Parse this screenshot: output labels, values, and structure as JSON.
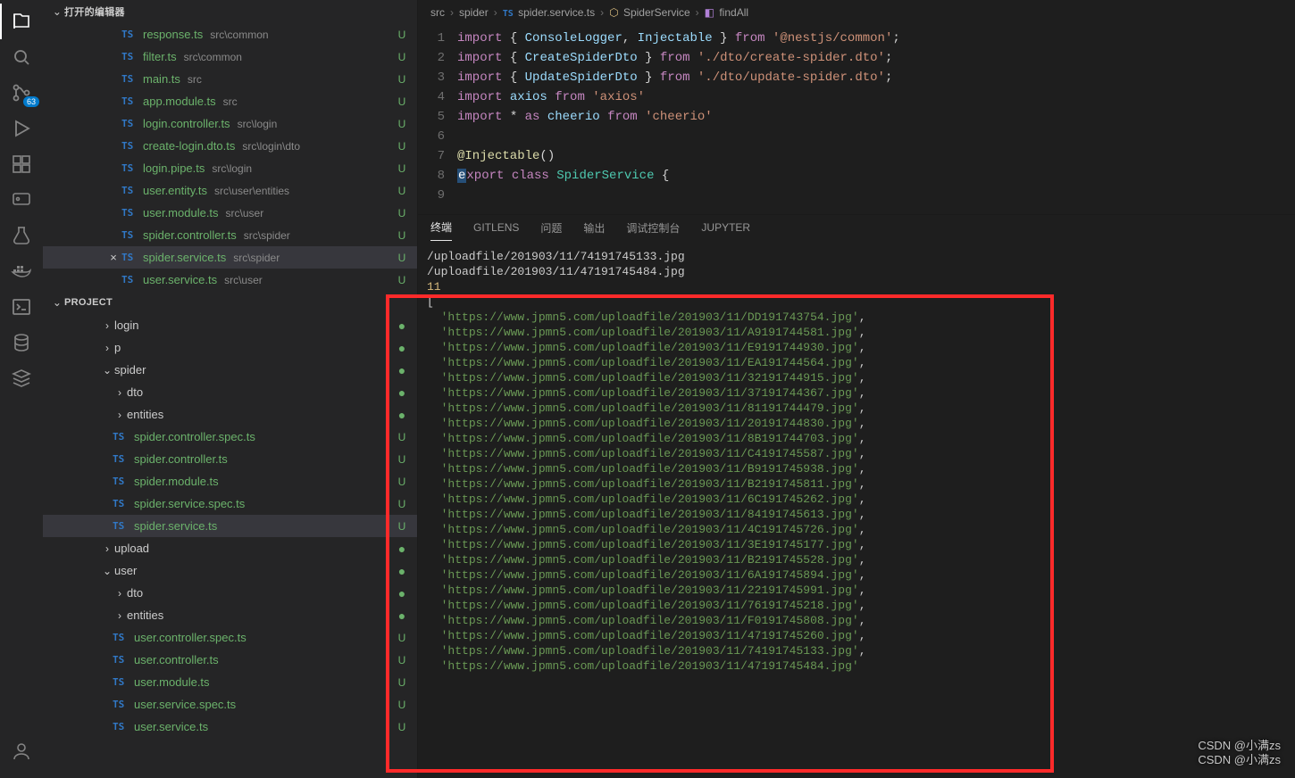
{
  "activity": {
    "icons": [
      {
        "name": "explorer-icon",
        "active": true
      },
      {
        "name": "search-icon"
      },
      {
        "name": "source-control-icon",
        "badge": "63"
      },
      {
        "name": "run-icon"
      },
      {
        "name": "extensions-icon"
      },
      {
        "name": "remote-icon"
      },
      {
        "name": "testing-icon"
      },
      {
        "name": "docker-icon"
      },
      {
        "name": "terminal-icon"
      },
      {
        "name": "database-icon"
      },
      {
        "name": "stack-icon"
      }
    ],
    "account_name": "account-icon"
  },
  "sidebar": {
    "openEditorsTitle": "打开的编辑器",
    "projectTitle": "PROJECT",
    "openEditors": [
      {
        "label": "response.ts",
        "dir": "src\\common",
        "status": "U"
      },
      {
        "label": "filter.ts",
        "dir": "src\\common",
        "status": "U"
      },
      {
        "label": "main.ts",
        "dir": "src",
        "status": "U"
      },
      {
        "label": "app.module.ts",
        "dir": "src",
        "status": "U"
      },
      {
        "label": "login.controller.ts",
        "dir": "src\\login",
        "status": "U"
      },
      {
        "label": "create-login.dto.ts",
        "dir": "src\\login\\dto",
        "status": "U"
      },
      {
        "label": "login.pipe.ts",
        "dir": "src\\login",
        "status": "U"
      },
      {
        "label": "user.entity.ts",
        "dir": "src\\user\\entities",
        "status": "U"
      },
      {
        "label": "user.module.ts",
        "dir": "src\\user",
        "status": "U"
      },
      {
        "label": "spider.controller.ts",
        "dir": "src\\spider",
        "status": "U"
      },
      {
        "label": "spider.service.ts",
        "dir": "src\\spider",
        "status": "U",
        "active": true
      },
      {
        "label": "user.service.ts",
        "dir": "src\\user",
        "status": "U"
      }
    ],
    "tree": [
      {
        "indent": 1,
        "chev": "›",
        "type": "folder",
        "label": "login",
        "status": "dot"
      },
      {
        "indent": 1,
        "chev": "›",
        "type": "folder",
        "label": "p",
        "status": "dot"
      },
      {
        "indent": 1,
        "chev": "⌄",
        "type": "folder",
        "label": "spider",
        "status": "dot"
      },
      {
        "indent": 2,
        "chev": "›",
        "type": "folder",
        "label": "dto",
        "status": "dot"
      },
      {
        "indent": 2,
        "chev": "›",
        "type": "folder",
        "label": "entities",
        "status": "dot"
      },
      {
        "indent": 2,
        "type": "ts",
        "label": "spider.controller.spec.ts",
        "status": "U"
      },
      {
        "indent": 2,
        "type": "ts",
        "label": "spider.controller.ts",
        "status": "U"
      },
      {
        "indent": 2,
        "type": "ts",
        "label": "spider.module.ts",
        "status": "U"
      },
      {
        "indent": 2,
        "type": "ts",
        "label": "spider.service.spec.ts",
        "status": "U"
      },
      {
        "indent": 2,
        "type": "ts",
        "label": "spider.service.ts",
        "status": "U",
        "selected": true
      },
      {
        "indent": 1,
        "chev": "›",
        "type": "folder",
        "label": "upload",
        "status": "dot"
      },
      {
        "indent": 1,
        "chev": "⌄",
        "type": "folder",
        "label": "user",
        "status": "dot"
      },
      {
        "indent": 2,
        "chev": "›",
        "type": "folder",
        "label": "dto",
        "status": "dot"
      },
      {
        "indent": 2,
        "chev": "›",
        "type": "folder",
        "label": "entities",
        "status": "dot"
      },
      {
        "indent": 2,
        "type": "ts",
        "label": "user.controller.spec.ts",
        "status": "U"
      },
      {
        "indent": 2,
        "type": "ts",
        "label": "user.controller.ts",
        "status": "U"
      },
      {
        "indent": 2,
        "type": "ts",
        "label": "user.module.ts",
        "status": "U"
      },
      {
        "indent": 2,
        "type": "ts",
        "label": "user.service.spec.ts",
        "status": "U"
      },
      {
        "indent": 2,
        "type": "ts",
        "label": "user.service.ts",
        "status": "U"
      }
    ]
  },
  "breadcrumbs": {
    "parts": [
      {
        "text": "src"
      },
      {
        "text": "spider"
      },
      {
        "icon": "ts",
        "text": "spider.service.ts"
      },
      {
        "icon": "class",
        "text": "SpiderService"
      },
      {
        "icon": "method",
        "text": "findAll"
      }
    ]
  },
  "code": {
    "lines": [
      1,
      2,
      3,
      4,
      5,
      6,
      7,
      8,
      9
    ],
    "l1": {
      "a": "import",
      "b": "ConsoleLogger",
      "c": "Injectable",
      "d": "from",
      "e": "'@nestjs/common'"
    },
    "l2": {
      "a": "import",
      "b": "CreateSpiderDto",
      "c": "from",
      "d": "'./dto/create-spider.dto'"
    },
    "l3": {
      "a": "import",
      "b": "UpdateSpiderDto",
      "c": "from",
      "d": "'./dto/update-spider.dto'"
    },
    "l4": {
      "a": "import",
      "b": "axios",
      "c": "from",
      "d": "'axios'"
    },
    "l5": {
      "a": "import",
      "star": "*",
      "as": "as",
      "b": "cheerio",
      "c": "from",
      "d": "'cheerio'"
    },
    "l7": {
      "a": "@Injectable",
      "p": "()"
    },
    "l8": {
      "e": "e",
      "a": "xport",
      "b": "class",
      "c": "SpiderService",
      "d": "{"
    }
  },
  "panel": {
    "tabs": [
      "终端",
      "GITLENS",
      "问题",
      "输出",
      "调试控制台",
      "JUPYTER"
    ],
    "activeTab": 0,
    "pre": [
      "/uploadfile/201903/11/74191745133.jpg",
      "/uploadfile/201903/11/47191745484.jpg"
    ],
    "count": "11",
    "open": "[",
    "host": "https://www.jpmn5.com",
    "urls": [
      "/uploadfile/201903/11/DD191743754.jpg",
      "/uploadfile/201903/11/A9191744581.jpg",
      "/uploadfile/201903/11/E9191744930.jpg",
      "/uploadfile/201903/11/EA191744564.jpg",
      "/uploadfile/201903/11/32191744915.jpg",
      "/uploadfile/201903/11/37191744367.jpg",
      "/uploadfile/201903/11/81191744479.jpg",
      "/uploadfile/201903/11/20191744830.jpg",
      "/uploadfile/201903/11/8B191744703.jpg",
      "/uploadfile/201903/11/C4191745587.jpg",
      "/uploadfile/201903/11/B9191745938.jpg",
      "/uploadfile/201903/11/B2191745811.jpg",
      "/uploadfile/201903/11/6C191745262.jpg",
      "/uploadfile/201903/11/84191745613.jpg",
      "/uploadfile/201903/11/4C191745726.jpg",
      "/uploadfile/201903/11/3E191745177.jpg",
      "/uploadfile/201903/11/B2191745528.jpg",
      "/uploadfile/201903/11/6A191745894.jpg",
      "/uploadfile/201903/11/22191745991.jpg",
      "/uploadfile/201903/11/76191745218.jpg",
      "/uploadfile/201903/11/F0191745808.jpg",
      "/uploadfile/201903/11/47191745260.jpg",
      "/uploadfile/201903/11/74191745133.jpg",
      "/uploadfile/201903/11/47191745484.jpg"
    ]
  },
  "watermark": {
    "a": "CSDN @小满zs",
    "b": "CSDN @小满zs"
  }
}
